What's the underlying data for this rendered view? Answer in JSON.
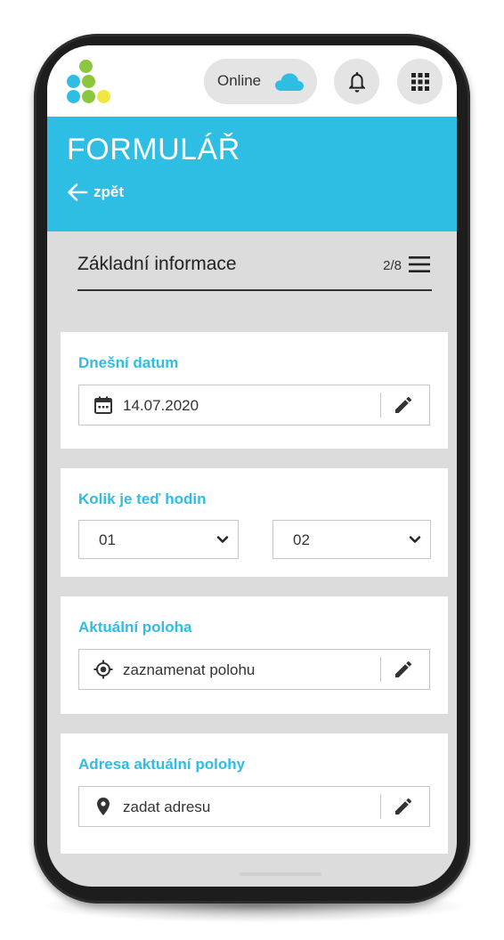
{
  "status": {
    "online_label": "Online"
  },
  "icons": {
    "logo_colors": [
      "#8cc63f",
      "#2ebde3",
      "#f2e640"
    ],
    "cloud": "cloud-icon",
    "bell": "bell-icon",
    "apps": "apps-grid-icon",
    "back": "arrow-left-icon",
    "menu": "hamburger-icon",
    "calendar": "calendar-icon",
    "edit": "pencil-icon",
    "location": "crosshair-icon",
    "pin": "map-pin-icon",
    "chevron": "chevron-down-icon"
  },
  "colors": {
    "accent": "#2ebde3",
    "background": "#dcdcdc"
  },
  "header": {
    "title": "FORMULÁŘ",
    "back_label": "zpět"
  },
  "section": {
    "title": "Základní informace",
    "progress": "2/8"
  },
  "fields": {
    "date": {
      "label": "Dnešní datum",
      "value": "14.07.2020"
    },
    "time": {
      "label": "Kolik je teď hodin",
      "hour": "01",
      "minute": "02"
    },
    "location": {
      "label": "Aktuální poloha",
      "value": "zaznamenat polohu"
    },
    "address": {
      "label": "Adresa aktuální polohy",
      "value": "zadat adresu"
    }
  }
}
